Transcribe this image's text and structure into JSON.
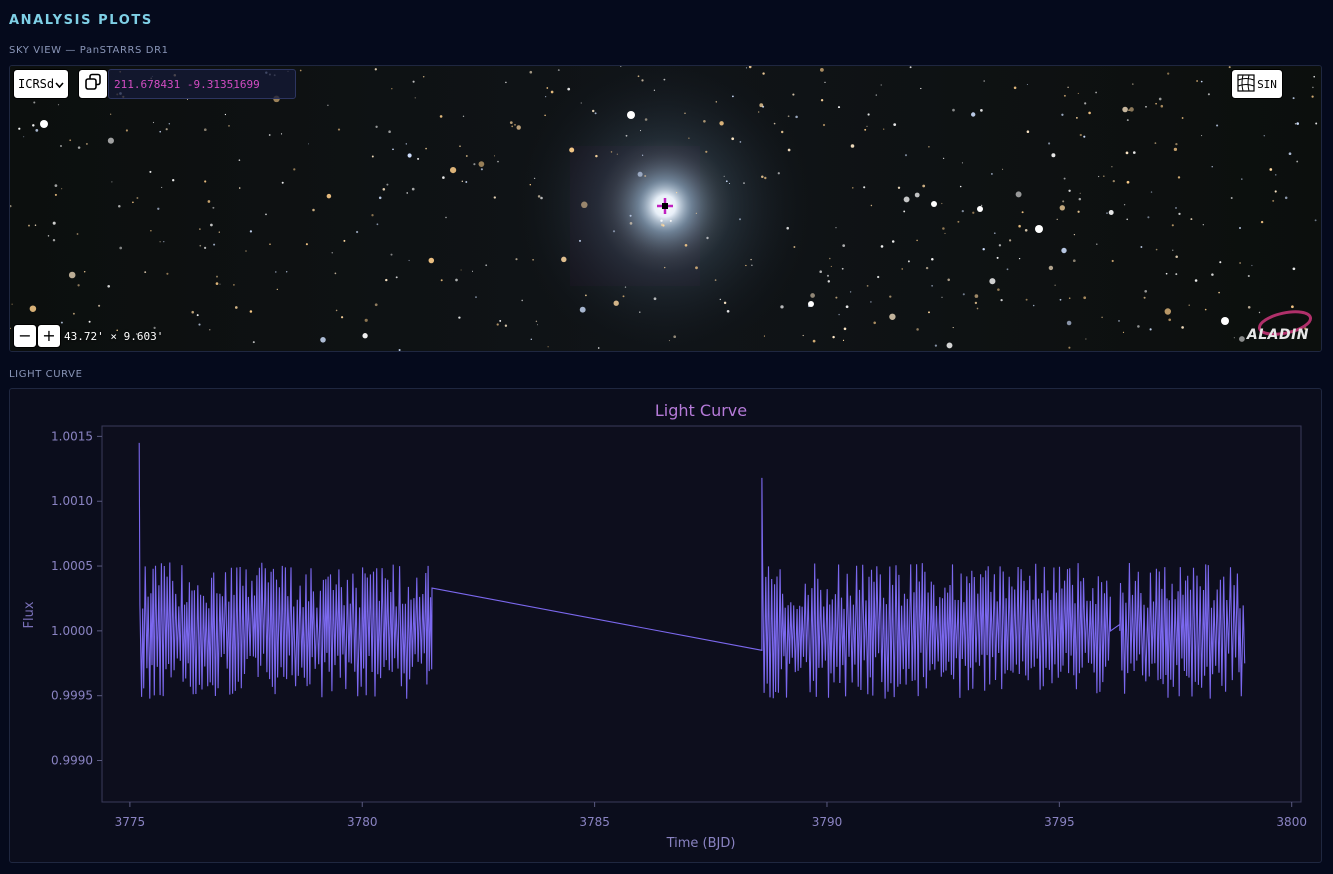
{
  "header": {
    "title": "ANALYSIS PLOTS"
  },
  "sky_view": {
    "label": "SKY VIEW — PanSTARRS DR1",
    "frame": "ICRSd",
    "coords": "211.678431 -9.31351699",
    "projection": "SIN",
    "fov": "43.72' × 9.603'",
    "zoom_out_label": "−",
    "zoom_in_label": "+",
    "logo": "ALADIN",
    "icons": [
      "chevron-down-icon",
      "copy-icon",
      "projection-grid-icon",
      "crosshair-icon"
    ]
  },
  "light_curve": {
    "label": "LIGHT CURVE",
    "chart_data": {
      "type": "line",
      "title": "Light Curve",
      "xlabel": "Time (BJD)",
      "ylabel": "Flux",
      "xlim": [
        3774.4,
        3800.2
      ],
      "ylim": [
        0.99868,
        1.00158
      ],
      "xticks": [
        3775,
        3780,
        3785,
        3790,
        3795,
        3800
      ],
      "yticks": [
        0.999,
        0.9995,
        1.0,
        1.0005,
        1.001,
        1.0015
      ],
      "ytick_labels": [
        "0.9990",
        "0.9995",
        "1.0000",
        "1.0005",
        "1.0010",
        "1.0015"
      ],
      "line_color": "#7b68ee",
      "grid": false,
      "series": [
        {
          "segments": [
            {
              "x_start": 3775.2,
              "x_end": 3781.5,
              "period": 0.062,
              "amplitude": 0.00048,
              "center": 1.0,
              "start_value": 1.00145
            },
            {
              "x_start": 3781.5,
              "x_end": 3788.6,
              "bridge": [
                1.00033,
                0.99985
              ]
            },
            {
              "x_start": 3788.6,
              "x_end": 3796.1,
              "period": 0.062,
              "amplitude": 0.00048,
              "center": 1.0,
              "start_value": 1.00118
            },
            {
              "x_start": 3796.1,
              "x_end": 3796.3,
              "bridge": [
                1.0,
                1.00005
              ]
            },
            {
              "x_start": 3796.3,
              "x_end": 3799.0,
              "period": 0.062,
              "amplitude": 0.00048,
              "center": 1.0,
              "start_value": 1.0
            }
          ],
          "range_min": 0.99885,
          "range_max": 1.00145
        }
      ]
    }
  }
}
